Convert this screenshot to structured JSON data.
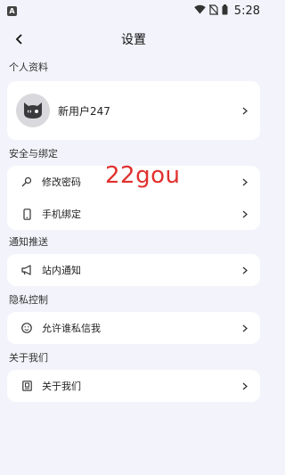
{
  "status_bar": {
    "app_icon_letter": "A",
    "time": "5:28"
  },
  "nav": {
    "title": "设置"
  },
  "sections": {
    "profile": {
      "title": "个人资料",
      "username": "新用户247"
    },
    "security": {
      "title": "安全与绑定",
      "items": [
        {
          "label": "修改密码",
          "icon": "key-icon"
        },
        {
          "label": "手机绑定",
          "icon": "phone-icon"
        }
      ]
    },
    "notification": {
      "title": "通知推送",
      "items": [
        {
          "label": "站内通知",
          "icon": "megaphone-icon"
        }
      ]
    },
    "privacy": {
      "title": "隐私控制",
      "items": [
        {
          "label": "允许谁私信我",
          "icon": "smiley-icon"
        }
      ]
    },
    "about": {
      "title": "关于我们",
      "items": [
        {
          "label": "关于我们",
          "icon": "info-box-icon"
        }
      ]
    }
  },
  "watermark": "22gou"
}
